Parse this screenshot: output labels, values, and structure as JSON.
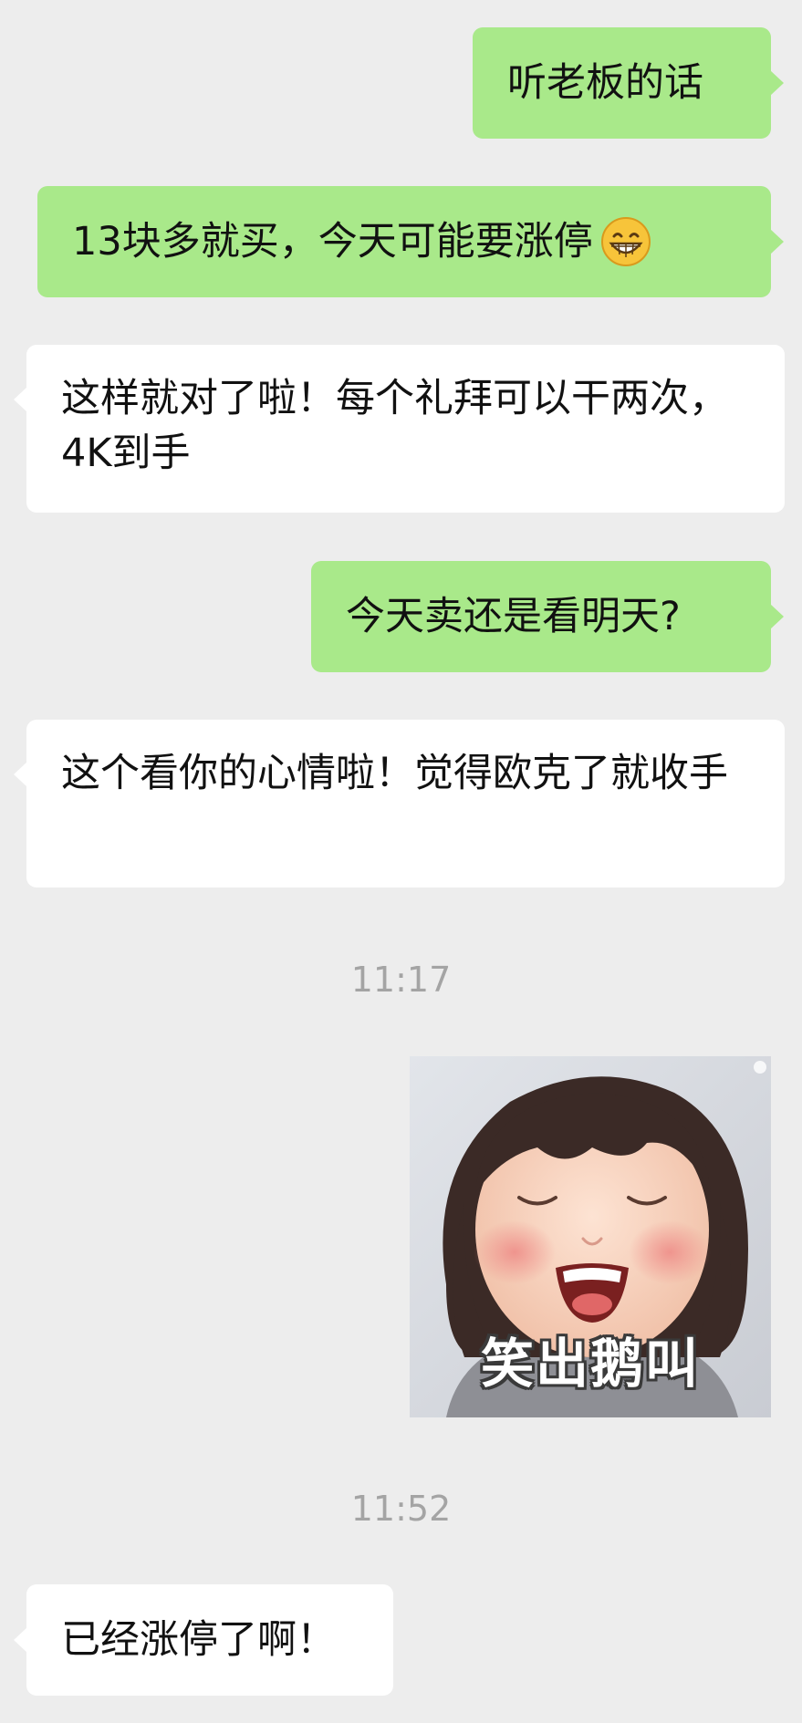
{
  "messages": [
    {
      "from": "me",
      "text": "听老板的话"
    },
    {
      "from": "me",
      "text": "13块多就买，今天可能要涨停",
      "emoji": "grinning-face-emoji"
    },
    {
      "from": "them",
      "text": "这样就对了啦！每个礼拜可以干两次，4K到手"
    },
    {
      "from": "me",
      "text": "今天卖还是看明天?"
    },
    {
      "from": "them",
      "text": "这个看你的心情啦！觉得欧克了就收手"
    },
    {
      "type": "timestamp",
      "text": "11:17"
    },
    {
      "from": "me",
      "type": "sticker",
      "caption": "笑出鹅叫",
      "icon": "laughing-child-sticker"
    },
    {
      "type": "timestamp",
      "text": "11:52"
    },
    {
      "from": "them",
      "text": "已经涨停了啊！"
    }
  ],
  "colors": {
    "background": "#ededed",
    "outgoing_bubble": "#a9e98a",
    "incoming_bubble": "#ffffff",
    "timestamp_text": "#a4a4a4"
  }
}
